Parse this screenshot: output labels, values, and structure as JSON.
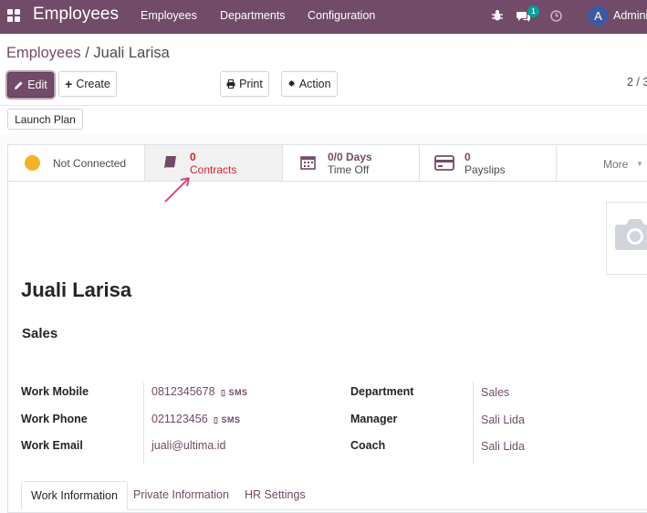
{
  "navbar": {
    "brand": "Employees",
    "menu": [
      "Employees",
      "Departments",
      "Configuration"
    ],
    "messages_badge": "1",
    "avatar_letter": "A",
    "user_name": "Adminis"
  },
  "breadcrumb": {
    "parent": "Employees",
    "separator": " / ",
    "current": "Juali Larisa"
  },
  "toolbar": {
    "edit": "Edit",
    "create": "Create",
    "print": "Print",
    "action": "Action",
    "pager": "2 / 3"
  },
  "launch_plan": "Launch Plan",
  "stat_buttons": {
    "im_status": "Not Connected",
    "contracts": {
      "value": "0",
      "label": "Contracts"
    },
    "time_off": {
      "value": "0/0 Days",
      "label": "Time Off"
    },
    "payslips": {
      "value": "0",
      "label": "Payslips"
    },
    "more": "More"
  },
  "employee": {
    "name": "Juali Larisa",
    "job": "Sales",
    "work_mobile_label": "Work Mobile",
    "work_mobile": "0812345678",
    "work_phone_label": "Work Phone",
    "work_phone": "021123456",
    "work_email_label": "Work Email",
    "work_email": "juali@ultima.id",
    "sms": "SMS",
    "department_label": "Department",
    "department": "Sales",
    "manager_label": "Manager",
    "manager": "Sali Lida",
    "coach_label": "Coach",
    "coach": "Sali Lida"
  },
  "tabs": [
    "Work Information",
    "Private Information",
    "HR Settings"
  ],
  "colors": {
    "brand": "#714b67",
    "annotation": "#e8336f",
    "status_idle": "#f4b12a"
  }
}
